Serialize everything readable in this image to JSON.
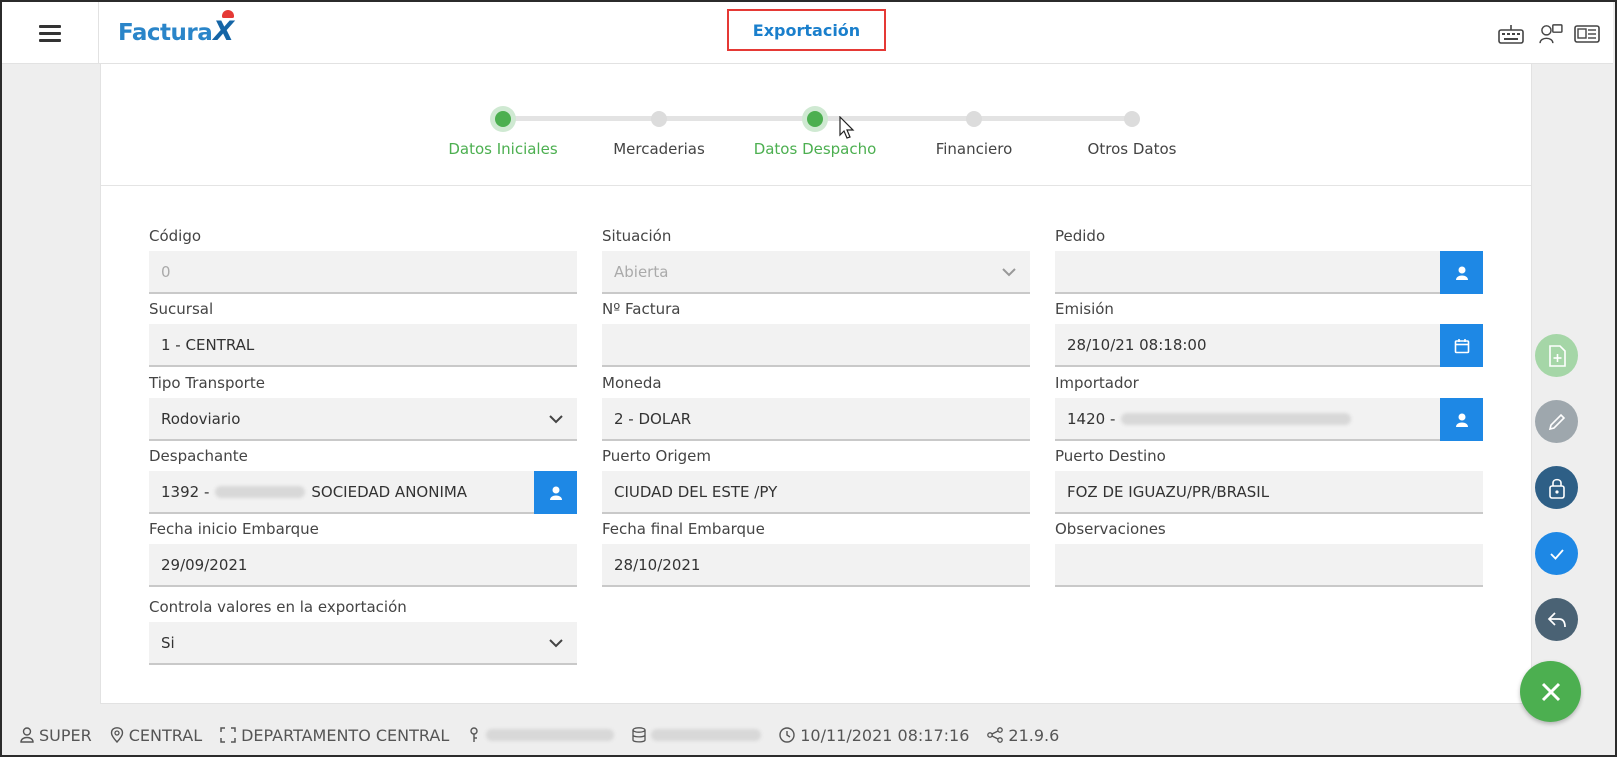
{
  "header": {
    "logo_text": "Factura",
    "logo_x": "X",
    "title": "Exportación"
  },
  "steps": [
    {
      "label": "Datos Iniciales",
      "active": true
    },
    {
      "label": "Mercaderias",
      "active": false
    },
    {
      "label": "Datos Despacho",
      "active": true
    },
    {
      "label": "Financiero",
      "active": false
    },
    {
      "label": "Otros Datos",
      "active": false
    }
  ],
  "form": {
    "codigo": {
      "label": "Código",
      "value": "0"
    },
    "situacion": {
      "label": "Situación",
      "value": "Abierta"
    },
    "pedido": {
      "label": "Pedido",
      "value": ""
    },
    "sucursal": {
      "label": "Sucursal",
      "value": "1 - CENTRAL"
    },
    "factura": {
      "label": "Nº Factura",
      "value": ""
    },
    "emision": {
      "label": "Emisión",
      "value": "28/10/21 08:18:00"
    },
    "tipo_transporte": {
      "label": "Tipo Transporte",
      "value": "Rodoviario"
    },
    "moneda": {
      "label": "Moneda",
      "value": "2 - DOLAR"
    },
    "importador": {
      "label": "Importador",
      "value_prefix": "1420 -"
    },
    "despachante": {
      "label": "Despachante",
      "value_prefix": "1392 -",
      "value_suffix": "SOCIEDAD ANONIMA"
    },
    "puerto_origem": {
      "label": "Puerto Origem",
      "value": "CIUDAD DEL ESTE /PY"
    },
    "puerto_destino": {
      "label": "Puerto Destino",
      "value": "FOZ DE IGUAZU/PR/BRASIL"
    },
    "fecha_inicio": {
      "label": "Fecha inicio Embarque",
      "value": "29/09/2021"
    },
    "fecha_final": {
      "label": "Fecha final Embarque",
      "value": "28/10/2021"
    },
    "observaciones": {
      "label": "Observaciones",
      "value": ""
    },
    "controla": {
      "label": "Controla valores en la exportación",
      "value": "Si"
    }
  },
  "footer": {
    "user": "SUPER",
    "location": "CENTRAL",
    "department": "DEPARTAMENTO CENTRAL",
    "datetime": "10/11/2021 08:17:16",
    "version": "21.9.6"
  },
  "colors": {
    "accent": "#1e88e5",
    "active_step": "#4caf50",
    "title": "#1a7fcc",
    "close_fab": "#4caf50",
    "title_border": "#e53935"
  },
  "icons": {
    "fabs": [
      "add-document-icon",
      "edit-pencil-icon",
      "lock-icon",
      "check-icon",
      "reply-icon",
      "close-icon"
    ]
  }
}
